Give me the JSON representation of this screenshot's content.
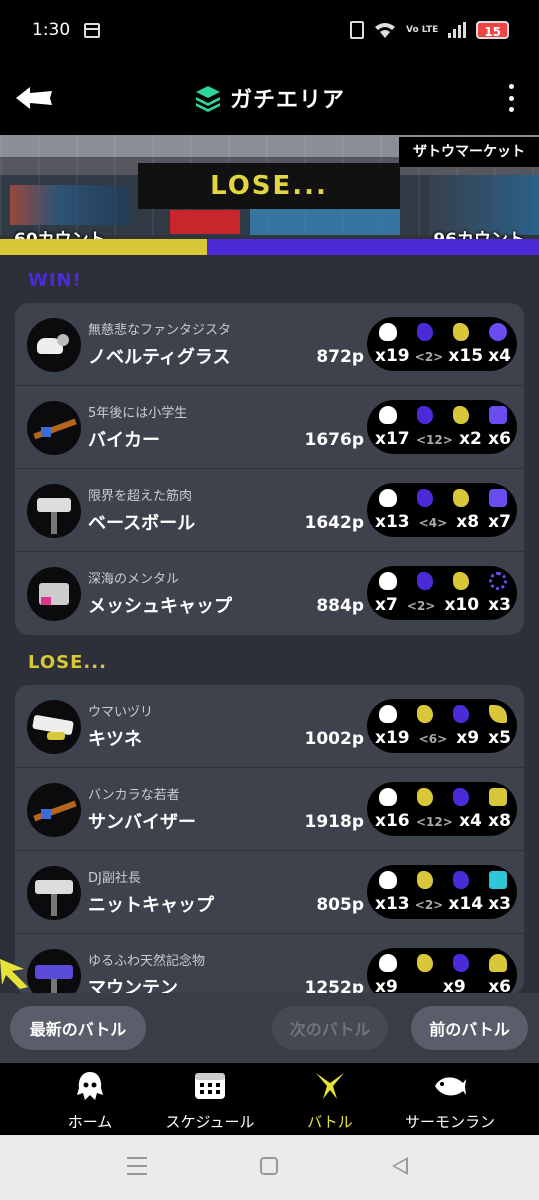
{
  "status_bar": {
    "time": "1:30",
    "volte": "Vo LTE",
    "battery": "15"
  },
  "header": {
    "title": "ガチエリア"
  },
  "banner": {
    "result": "LOSE...",
    "stage": "ザトウマーケット",
    "left_count": "60カウント",
    "right_count": "96カウント"
  },
  "sections": {
    "win_label": "WIN!",
    "lose_label": "LOSE..."
  },
  "win_players": [
    {
      "badge": "無慈悲なファンタジスタ",
      "name": "ノベルティグラス",
      "points": "872p",
      "kills": "x19",
      "assists": "<2>",
      "deaths": "x15",
      "specials": "x4"
    },
    {
      "badge": "5年後には小学生",
      "name": "バイカー",
      "points": "1676p",
      "kills": "x17",
      "assists": "<12>",
      "deaths": "x2",
      "specials": "x6"
    },
    {
      "badge": "限界を超えた筋肉",
      "name": "ベースボール",
      "points": "1642p",
      "kills": "x13",
      "assists": "<4>",
      "deaths": "x8",
      "specials": "x7"
    },
    {
      "badge": "深海のメンタル",
      "name": "メッシュキャップ",
      "points": "884p",
      "kills": "x7",
      "assists": "<2>",
      "deaths": "x10",
      "specials": "x3"
    }
  ],
  "lose_players": [
    {
      "badge": "ウマいヅリ",
      "name": "キツネ",
      "points": "1002p",
      "kills": "x19",
      "assists": "<6>",
      "deaths": "x9",
      "specials": "x5"
    },
    {
      "badge": "バンカラな若者",
      "name": "サンバイザー",
      "points": "1918p",
      "kills": "x16",
      "assists": "<12>",
      "deaths": "x4",
      "specials": "x8"
    },
    {
      "badge": "DJ副社長",
      "name": "ニットキャップ",
      "points": "805p",
      "kills": "x13",
      "assists": "<2>",
      "deaths": "x14",
      "specials": "x3"
    },
    {
      "badge": "ゆるふわ天然記念物",
      "name": "マウンテン",
      "points": "1252p",
      "kills": "x9",
      "assists": "",
      "deaths": "x9",
      "specials": "x6"
    }
  ],
  "actions": {
    "latest": "最新のバトル",
    "next": "次のバトル",
    "prev": "前のバトル"
  },
  "tabs": {
    "home": "ホーム",
    "schedule": "スケジュール",
    "battle": "バトル",
    "salmon": "サーモンラン"
  },
  "colors": {
    "win": "#4b2bd7",
    "lose": "#d9c73a",
    "active_tab": "#e6e23a"
  }
}
